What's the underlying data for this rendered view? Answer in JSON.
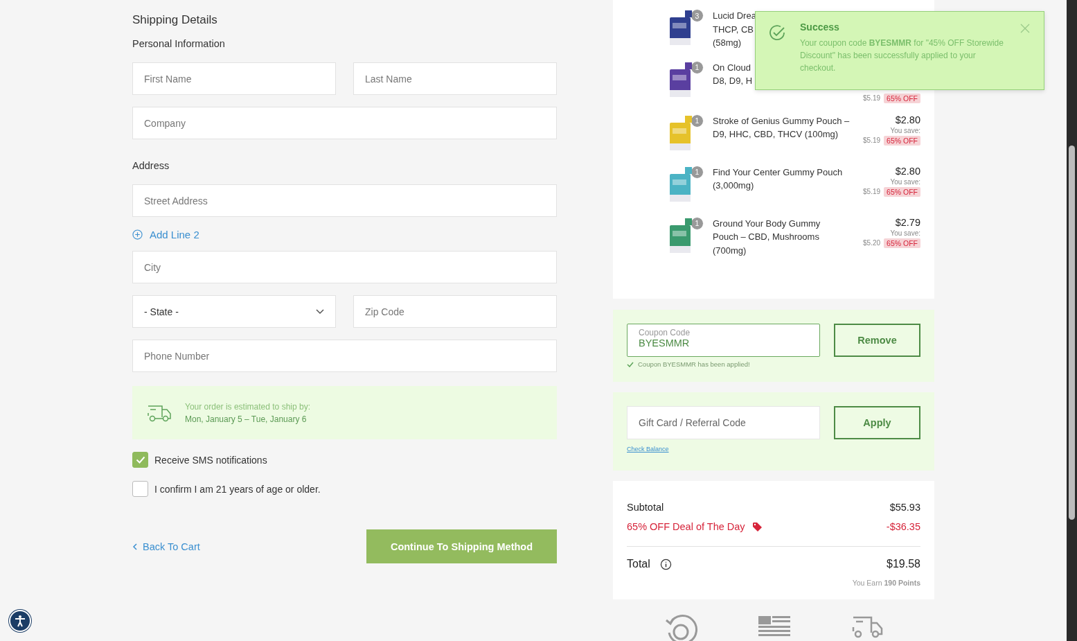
{
  "form": {
    "title": "Shipping Details",
    "sections": [
      {
        "heading": "Personal Information",
        "rows": [
          {
            "kind": "fields",
            "fields": [
              {
                "kind": "input",
                "placeholder": "First Name"
              },
              {
                "kind": "input",
                "placeholder": "Last Name"
              }
            ]
          },
          {
            "kind": "fields",
            "fields": [
              {
                "kind": "input",
                "placeholder": "Company"
              }
            ]
          }
        ]
      },
      {
        "heading": "Address",
        "rows": [
          {
            "kind": "fields",
            "fields": [
              {
                "kind": "input",
                "placeholder": "Street Address"
              }
            ]
          },
          {
            "kind": "link",
            "label": "Add Line 2"
          },
          {
            "kind": "fields",
            "fields": [
              {
                "kind": "input",
                "placeholder": "City"
              }
            ]
          },
          {
            "kind": "fields",
            "fields": [
              {
                "kind": "select",
                "value": "- State -"
              },
              {
                "kind": "input",
                "placeholder": "Zip Code"
              }
            ]
          },
          {
            "kind": "fields",
            "fields": [
              {
                "kind": "input",
                "placeholder": "Phone Number"
              }
            ]
          }
        ]
      }
    ],
    "shipping_estimate": {
      "label": "Your order is estimated to ship by:",
      "dates": "Mon, January 5 – Tue, January 6"
    },
    "checkboxes": [
      {
        "label": "Receive SMS notifications",
        "checked": true
      },
      {
        "label": "I confirm I am 21 years of age or older.",
        "checked": false
      }
    ],
    "back_link": "Back To Cart",
    "continue_button": "Continue To Shipping Method"
  },
  "cart": {
    "items": [
      {
        "name_lines": [
          "Lucid Drea",
          "THCP, CB",
          "(58mg)"
        ],
        "quantity": "3",
        "color": "#2f3f8f"
      },
      {
        "name_lines": [
          "On Cloud",
          "D8, D9, H"
        ],
        "quantity": "1",
        "color": "#5a3fa0",
        "original": "$5.19",
        "discount": "65% OFF"
      },
      {
        "name_lines": [
          "Stroke of Genius Gummy Pouch –",
          "D9, HHC, CBD, THCV (100mg)"
        ],
        "quantity": "1",
        "color": "#e6c22a",
        "price": "$2.80",
        "save_label": "You save:",
        "original": "$5.19",
        "discount": "65% OFF"
      },
      {
        "name_lines": [
          "Find Your Center Gummy Pouch",
          "(3,000mg)"
        ],
        "quantity": "1",
        "color": "#4bb3c4",
        "price": "$2.80",
        "save_label": "You save:",
        "original": "$5.19",
        "discount": "65% OFF"
      },
      {
        "name_lines": [
          "Ground Your Body Gummy",
          "Pouch – CBD, Mushrooms",
          "(700mg)"
        ],
        "quantity": "1",
        "color": "#3a9a6e",
        "price": "$2.79",
        "save_label": "You save:",
        "original": "$5.20",
        "discount": "65% OFF"
      }
    ],
    "coupon": {
      "label": "Coupon Code",
      "value": "BYESMMR",
      "button": "Remove",
      "note": "Coupon BYESMMR has been applied!"
    },
    "gift": {
      "placeholder": "Gift Card / Referral Code",
      "button": "Apply",
      "link": "Check Balance"
    },
    "summary": {
      "subtotal_label": "Subtotal",
      "subtotal": "$55.93",
      "discount_label": "65% OFF Deal of The Day",
      "discount": "-$36.35",
      "total_label": "Total",
      "total": "$19.58",
      "points": "You Earn **190 Points**"
    }
  },
  "toast": {
    "title": "Success",
    "message": "Your coupon code **BYESMMR** for \"45% OFF Storewide Discount\" has been successfully applied to your checkout."
  }
}
